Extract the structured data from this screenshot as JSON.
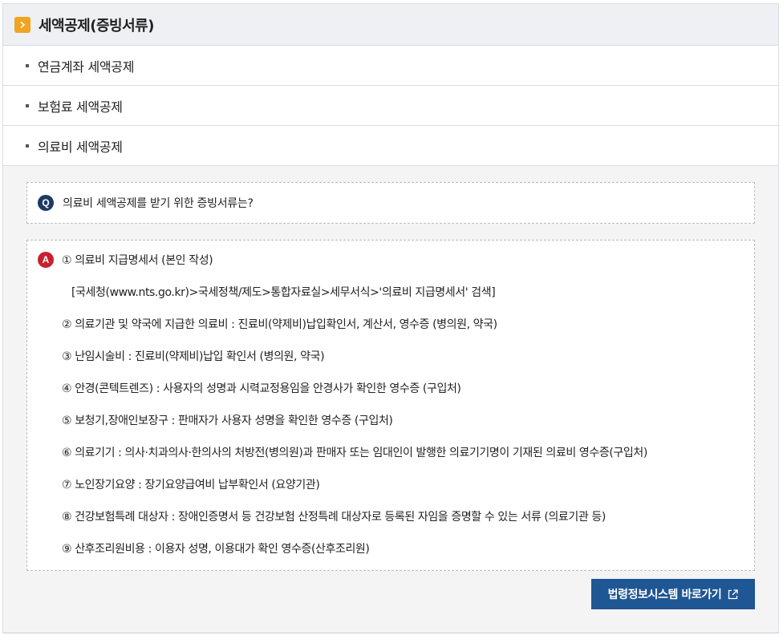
{
  "header": {
    "title": "세액공제(증빙서류)",
    "icon": "chevron-right-icon",
    "icon_color": "#f0a422"
  },
  "menu": {
    "items": [
      {
        "label": "연금계좌 세액공제"
      },
      {
        "label": "보험료 세액공제"
      },
      {
        "label": "의료비 세액공제"
      }
    ]
  },
  "question": {
    "badge": "Q",
    "text": "의료비 세액공제를 받기 위한 증빙서류는?"
  },
  "answer": {
    "badge": "A",
    "lines": [
      "① 의료비 지급명세서 (본인 작성)",
      "[국세청(www.nts.go.kr)>국세정책/제도>통합자료실>세무서식>'의료비 지급명세서' 검색]",
      "② 의료기관 및 약국에 지급한 의료비 : 진료비(약제비)납입확인서, 계산서, 영수증 (병의원, 약국)",
      "③ 난임시술비 : 진료비(약제비)납입 확인서 (병의원, 약국)",
      "④ 안경(콘텍트렌즈) : 사용자의 성명과 시력교정용임을 안경사가 확인한 영수증 (구입처)",
      "⑤ 보청기,장애인보장구 : 판매자가 사용자 성명을 확인한 영수증 (구입처)",
      "⑥ 의료기기 : 의사·치과의사·한의사의 처방전(병의원)과 판매자 또는 임대인이 발행한 의료기기명이 기재된 의료비 영수증(구입처)",
      "⑦ 노인장기요양 : 장기요양급여비 납부확인서 (요양기관)",
      "⑧ 건강보험특례 대상자 : 장애인증명서 등 건강보험 산정특례 대상자로 등록된 자임을 증명할 수 있는 서류 (의료기관 등)",
      "⑨ 산후조리원비용 : 이용자 성명, 이용대가 확인 영수증(산후조리원)"
    ]
  },
  "link_button": {
    "label": "법령정보시스템 바로가기",
    "icon": "external-link-icon",
    "color": "#1f5694"
  }
}
